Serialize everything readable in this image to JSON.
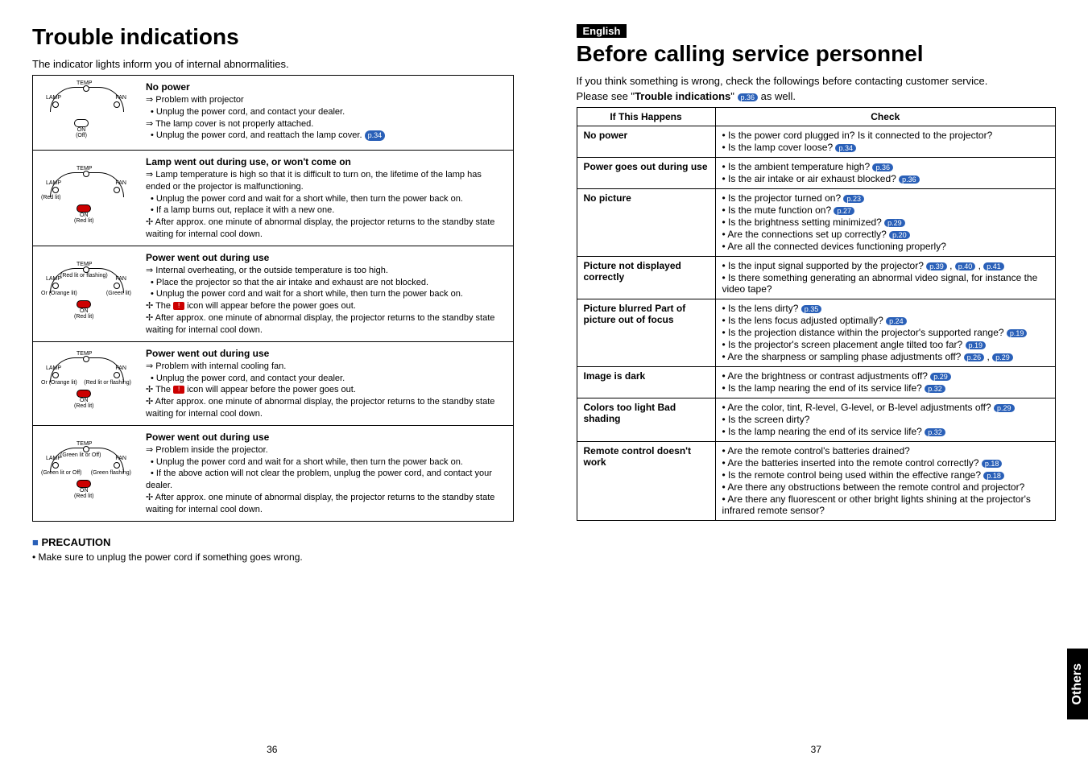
{
  "left": {
    "title": "Trouble indications",
    "intro": "The indicator lights inform you of internal abnormalities.",
    "rows": [
      {
        "heading": "No power",
        "diagram": {
          "on_label": "ON",
          "on_sub": "(Off)",
          "on_red": false,
          "lamp_sub": "",
          "fan_sub": "",
          "temp_sub": ""
        },
        "lines": [
          {
            "cls": "arrow",
            "text": "Problem with projector"
          },
          {
            "cls": "bullet",
            "text": "Unplug the power cord, and contact your dealer."
          },
          {
            "cls": "arrow",
            "text": "The lamp cover is not properly attached."
          },
          {
            "cls": "bullet",
            "text": "Unplug the power cord, and reattach the lamp cover.",
            "ref": "p.34"
          }
        ]
      },
      {
        "heading": "Lamp went out during use, or won't come on",
        "diagram": {
          "on_label": "ON",
          "on_sub": "(Red lit)",
          "on_red": true,
          "lamp_sub": "(Red lit)",
          "fan_sub": "",
          "temp_sub": ""
        },
        "lines": [
          {
            "cls": "arrow",
            "text": "Lamp temperature is high so that it is difficult to turn on, the lifetime of the lamp has ended or the projector is malfunctioning."
          },
          {
            "cls": "bullet",
            "text": "Unplug the power cord and wait for a short while, then turn the power back on."
          },
          {
            "cls": "bullet",
            "text": "If a lamp burns out, replace it with a new one."
          },
          {
            "cls": "note",
            "text": "After approx. one minute of abnormal display, the projector returns to the standby state waiting for internal cool down."
          }
        ]
      },
      {
        "heading": "Power went out during use",
        "diagram": {
          "on_label": "ON",
          "on_sub": "(Red lit)",
          "on_red": true,
          "lamp_sub": "Or (Orange lit)",
          "fan_sub": "(Green lit)",
          "temp_sub": "(Red lit or flashing)"
        },
        "lines": [
          {
            "cls": "arrow",
            "text": "Internal overheating, or the outside temperature is too high."
          },
          {
            "cls": "bullet",
            "text": "Place the projector so that the air intake and exhaust are not blocked."
          },
          {
            "cls": "bullet",
            "text": "Unplug the power cord and wait for a short while, then turn the power back on."
          },
          {
            "cls": "note",
            "text": "The",
            "icon": "temp",
            "text2": "icon will appear before the power goes out."
          },
          {
            "cls": "note",
            "text": "After approx. one minute of abnormal display, the projector returns to the standby state waiting for internal cool down."
          }
        ]
      },
      {
        "heading": "Power went out during use",
        "diagram": {
          "on_label": "ON",
          "on_sub": "(Red lit)",
          "on_red": true,
          "lamp_sub": "Or (Orange lit)",
          "fan_sub": "(Red lit or flashing)",
          "temp_sub": ""
        },
        "lines": [
          {
            "cls": "arrow",
            "text": "Problem with internal cooling fan."
          },
          {
            "cls": "bullet",
            "text": "Unplug the power cord, and contact your dealer."
          },
          {
            "cls": "note",
            "text": "The",
            "icon": "fan",
            "text2": "icon will appear before the power goes out."
          },
          {
            "cls": "note",
            "text": "After approx. one minute of abnormal display, the projector returns to the standby state waiting for internal cool down."
          }
        ]
      },
      {
        "heading": "Power went out during use",
        "diagram": {
          "on_label": "ON",
          "on_sub": "(Red lit)",
          "on_red": true,
          "lamp_sub": "(Green lit or Off)",
          "fan_sub": "(Green flashing)",
          "temp_sub": "(Green lit or Off)"
        },
        "lines": [
          {
            "cls": "arrow",
            "text": "Problem inside the projector."
          },
          {
            "cls": "bullet",
            "text": "Unplug the power cord and wait for a short while, then turn the power back on."
          },
          {
            "cls": "bullet",
            "text": "If the above action will not clear the problem, unplug  the power cord, and contact your dealer."
          },
          {
            "cls": "note",
            "text": "After approx. one minute of abnormal display, the projector returns to the standby state waiting for internal cool down."
          }
        ]
      }
    ],
    "precaution_head": "PRECAUTION",
    "precaution_text": "• Make sure to unplug the power cord if something goes wrong.",
    "page_num": "36"
  },
  "right": {
    "lang_tag": "English",
    "title": "Before calling service personnel",
    "intro1": "If you think something is wrong, check the followings before contacting customer service.",
    "intro2a": "Please see \"",
    "intro2b": "Trouble indications",
    "intro2c": "\"",
    "intro_ref": "p.36",
    "intro2d": " as well.",
    "th_left": "If  This Happens",
    "th_right": "Check",
    "rows": [
      {
        "label": "No power",
        "checks": [
          {
            "text": "Is the power cord plugged in? Is it connected to the projector?"
          },
          {
            "text": "Is the lamp cover loose?",
            "ref": "p.34"
          }
        ]
      },
      {
        "label": "Power goes out during use",
        "checks": [
          {
            "text": "Is the ambient temperature high?",
            "ref": "p.36"
          },
          {
            "text": "Is the air intake or air exhaust blocked?",
            "ref": "p.36"
          }
        ]
      },
      {
        "label": "No picture",
        "checks": [
          {
            "text": "Is the projector turned on?",
            "ref": "p.23"
          },
          {
            "text": "Is the mute function on?",
            "ref": "p.27"
          },
          {
            "text": "Is the brightness setting minimized?",
            "ref": "p.29"
          },
          {
            "text": "Are the connections set up correctly?",
            "ref": "p.20"
          },
          {
            "text": "Are all the connected devices functioning properly?"
          }
        ]
      },
      {
        "label": "Picture not displayed correctly",
        "checks": [
          {
            "text": "Is the input signal supported by the projector?",
            "refs": [
              "p.39",
              "p.40",
              "p.41"
            ]
          },
          {
            "text": "Is there something generating an abnormal video signal, for instance the video tape?"
          }
        ]
      },
      {
        "label": "Picture blurred Part of picture out of focus",
        "checks": [
          {
            "text": "Is the lens dirty?",
            "ref": "p.35"
          },
          {
            "text": "Is the lens focus adjusted optimally?",
            "ref": "p.24"
          },
          {
            "text": "Is the projection distance within the projector's supported range?",
            "ref": "p.19"
          },
          {
            "text": "Is the projector's screen placement angle tilted too far?",
            "ref": "p.19"
          },
          {
            "text": "Are the sharpness or sampling phase adjustments off?",
            "refs": [
              "p.26",
              "p.29"
            ]
          }
        ]
      },
      {
        "label": "Image is dark",
        "checks": [
          {
            "text": "Are the brightness or contrast adjustments off?",
            "ref": "p.29"
          },
          {
            "text": "Is the lamp nearing the end of its service life?",
            "ref": "p.32"
          }
        ]
      },
      {
        "label": "Colors too light Bad shading",
        "checks": [
          {
            "text": "Are the color, tint, R-level, G-level, or B-level adjustments off?",
            "ref": "p.29"
          },
          {
            "text": "Is the screen dirty?"
          },
          {
            "text": "Is the lamp nearing the end of its service life?",
            "ref": "p.32"
          }
        ]
      },
      {
        "label": "Remote control doesn't work",
        "checks": [
          {
            "text": "Are the remote control's batteries drained?"
          },
          {
            "text": "Are the batteries inserted into the remote control correctly?",
            "ref": "p.18"
          },
          {
            "text": "Is the remote control being used within the effective range?",
            "ref": "p.18"
          },
          {
            "text": "Are there any obstructions between the remote control and projector?"
          },
          {
            "text": "Are there any fluorescent or other bright lights shining at the projector's infrared remote sensor?"
          }
        ]
      }
    ],
    "page_num": "37",
    "sidebar": "Others"
  }
}
